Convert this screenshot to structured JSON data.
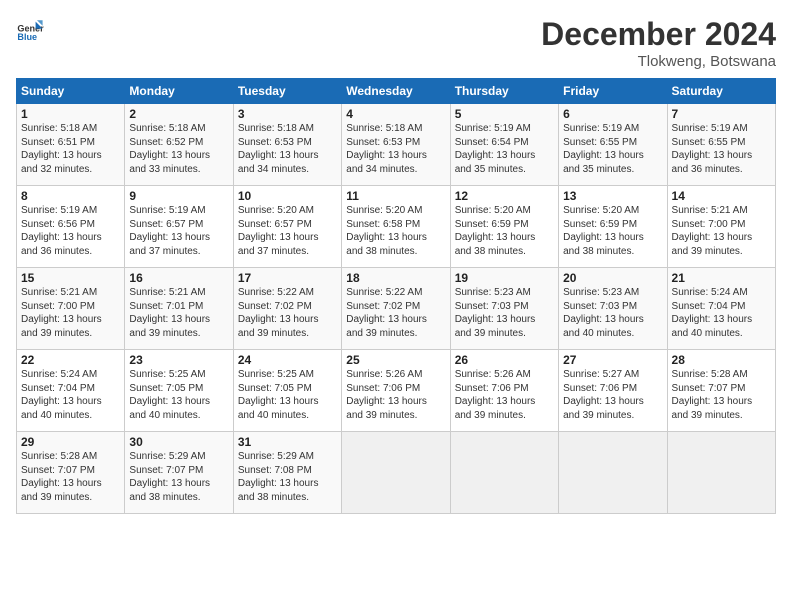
{
  "logo": {
    "line1": "General",
    "line2": "Blue"
  },
  "header": {
    "month_year": "December 2024",
    "location": "Tlokweng, Botswana"
  },
  "weekdays": [
    "Sunday",
    "Monday",
    "Tuesday",
    "Wednesday",
    "Thursday",
    "Friday",
    "Saturday"
  ],
  "weeks": [
    [
      {
        "day": "1",
        "sunrise": "5:18 AM",
        "sunset": "6:51 PM",
        "daylight": "13 hours and 32 minutes."
      },
      {
        "day": "2",
        "sunrise": "5:18 AM",
        "sunset": "6:52 PM",
        "daylight": "13 hours and 33 minutes."
      },
      {
        "day": "3",
        "sunrise": "5:18 AM",
        "sunset": "6:53 PM",
        "daylight": "13 hours and 34 minutes."
      },
      {
        "day": "4",
        "sunrise": "5:18 AM",
        "sunset": "6:53 PM",
        "daylight": "13 hours and 34 minutes."
      },
      {
        "day": "5",
        "sunrise": "5:19 AM",
        "sunset": "6:54 PM",
        "daylight": "13 hours and 35 minutes."
      },
      {
        "day": "6",
        "sunrise": "5:19 AM",
        "sunset": "6:55 PM",
        "daylight": "13 hours and 35 minutes."
      },
      {
        "day": "7",
        "sunrise": "5:19 AM",
        "sunset": "6:55 PM",
        "daylight": "13 hours and 36 minutes."
      }
    ],
    [
      {
        "day": "8",
        "sunrise": "5:19 AM",
        "sunset": "6:56 PM",
        "daylight": "13 hours and 36 minutes."
      },
      {
        "day": "9",
        "sunrise": "5:19 AM",
        "sunset": "6:57 PM",
        "daylight": "13 hours and 37 minutes."
      },
      {
        "day": "10",
        "sunrise": "5:20 AM",
        "sunset": "6:57 PM",
        "daylight": "13 hours and 37 minutes."
      },
      {
        "day": "11",
        "sunrise": "5:20 AM",
        "sunset": "6:58 PM",
        "daylight": "13 hours and 38 minutes."
      },
      {
        "day": "12",
        "sunrise": "5:20 AM",
        "sunset": "6:59 PM",
        "daylight": "13 hours and 38 minutes."
      },
      {
        "day": "13",
        "sunrise": "5:20 AM",
        "sunset": "6:59 PM",
        "daylight": "13 hours and 38 minutes."
      },
      {
        "day": "14",
        "sunrise": "5:21 AM",
        "sunset": "7:00 PM",
        "daylight": "13 hours and 39 minutes."
      }
    ],
    [
      {
        "day": "15",
        "sunrise": "5:21 AM",
        "sunset": "7:00 PM",
        "daylight": "13 hours and 39 minutes."
      },
      {
        "day": "16",
        "sunrise": "5:21 AM",
        "sunset": "7:01 PM",
        "daylight": "13 hours and 39 minutes."
      },
      {
        "day": "17",
        "sunrise": "5:22 AM",
        "sunset": "7:02 PM",
        "daylight": "13 hours and 39 minutes."
      },
      {
        "day": "18",
        "sunrise": "5:22 AM",
        "sunset": "7:02 PM",
        "daylight": "13 hours and 39 minutes."
      },
      {
        "day": "19",
        "sunrise": "5:23 AM",
        "sunset": "7:03 PM",
        "daylight": "13 hours and 39 minutes."
      },
      {
        "day": "20",
        "sunrise": "5:23 AM",
        "sunset": "7:03 PM",
        "daylight": "13 hours and 40 minutes."
      },
      {
        "day": "21",
        "sunrise": "5:24 AM",
        "sunset": "7:04 PM",
        "daylight": "13 hours and 40 minutes."
      }
    ],
    [
      {
        "day": "22",
        "sunrise": "5:24 AM",
        "sunset": "7:04 PM",
        "daylight": "13 hours and 40 minutes."
      },
      {
        "day": "23",
        "sunrise": "5:25 AM",
        "sunset": "7:05 PM",
        "daylight": "13 hours and 40 minutes."
      },
      {
        "day": "24",
        "sunrise": "5:25 AM",
        "sunset": "7:05 PM",
        "daylight": "13 hours and 40 minutes."
      },
      {
        "day": "25",
        "sunrise": "5:26 AM",
        "sunset": "7:06 PM",
        "daylight": "13 hours and 39 minutes."
      },
      {
        "day": "26",
        "sunrise": "5:26 AM",
        "sunset": "7:06 PM",
        "daylight": "13 hours and 39 minutes."
      },
      {
        "day": "27",
        "sunrise": "5:27 AM",
        "sunset": "7:06 PM",
        "daylight": "13 hours and 39 minutes."
      },
      {
        "day": "28",
        "sunrise": "5:28 AM",
        "sunset": "7:07 PM",
        "daylight": "13 hours and 39 minutes."
      }
    ],
    [
      {
        "day": "29",
        "sunrise": "5:28 AM",
        "sunset": "7:07 PM",
        "daylight": "13 hours and 39 minutes."
      },
      {
        "day": "30",
        "sunrise": "5:29 AM",
        "sunset": "7:07 PM",
        "daylight": "13 hours and 38 minutes."
      },
      {
        "day": "31",
        "sunrise": "5:29 AM",
        "sunset": "7:08 PM",
        "daylight": "13 hours and 38 minutes."
      },
      null,
      null,
      null,
      null
    ]
  ],
  "labels": {
    "sunrise": "Sunrise:",
    "sunset": "Sunset:",
    "daylight": "Daylight:"
  }
}
